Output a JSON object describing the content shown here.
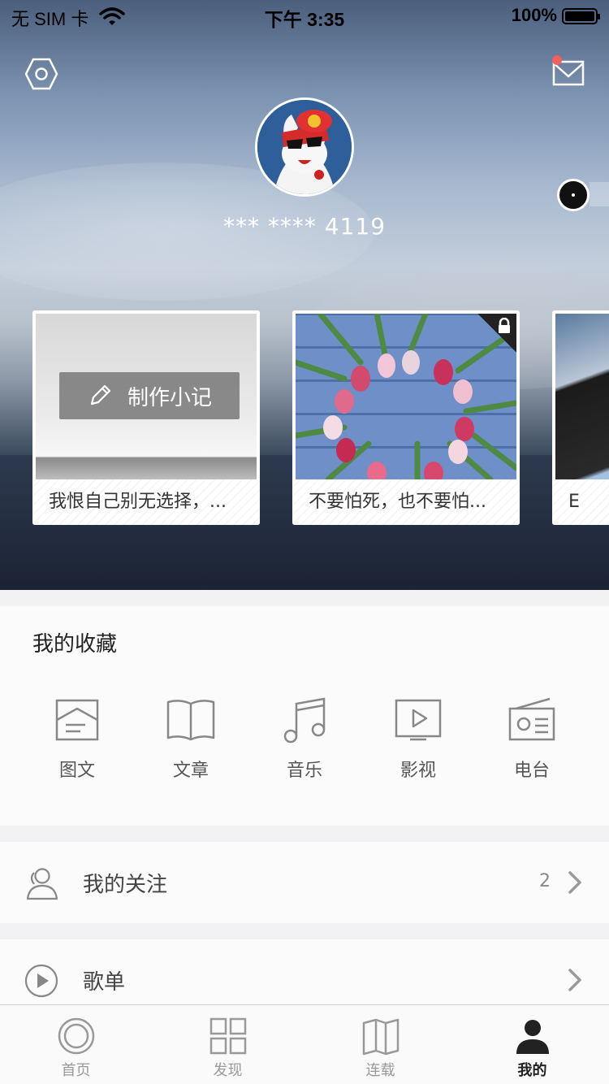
{
  "status_bar": {
    "carrier": "无 SIM 卡",
    "time": "下午 3:35",
    "battery": "100%"
  },
  "profile": {
    "username": "*** **** 4119"
  },
  "cards": [
    {
      "caption": "我恨自己别无选择，...",
      "action": "制作小记"
    },
    {
      "caption": "不要怕死，也不要怕..."
    },
    {
      "caption": "E"
    }
  ],
  "collection": {
    "title": "我的收藏",
    "items": [
      {
        "label": "图文",
        "icon": "image-text-icon"
      },
      {
        "label": "文章",
        "icon": "book-icon"
      },
      {
        "label": "音乐",
        "icon": "music-note-icon"
      },
      {
        "label": "影视",
        "icon": "video-icon"
      },
      {
        "label": "电台",
        "icon": "radio-icon"
      }
    ]
  },
  "following": {
    "label": "我的关注",
    "count": "2"
  },
  "playlist": {
    "label": "歌单"
  },
  "tabs": [
    {
      "label": "首页",
      "icon": "home-circle-icon"
    },
    {
      "label": "发现",
      "icon": "grid-icon"
    },
    {
      "label": "连载",
      "icon": "book-open-icon"
    },
    {
      "label": "我的",
      "icon": "person-icon",
      "active": true
    }
  ]
}
